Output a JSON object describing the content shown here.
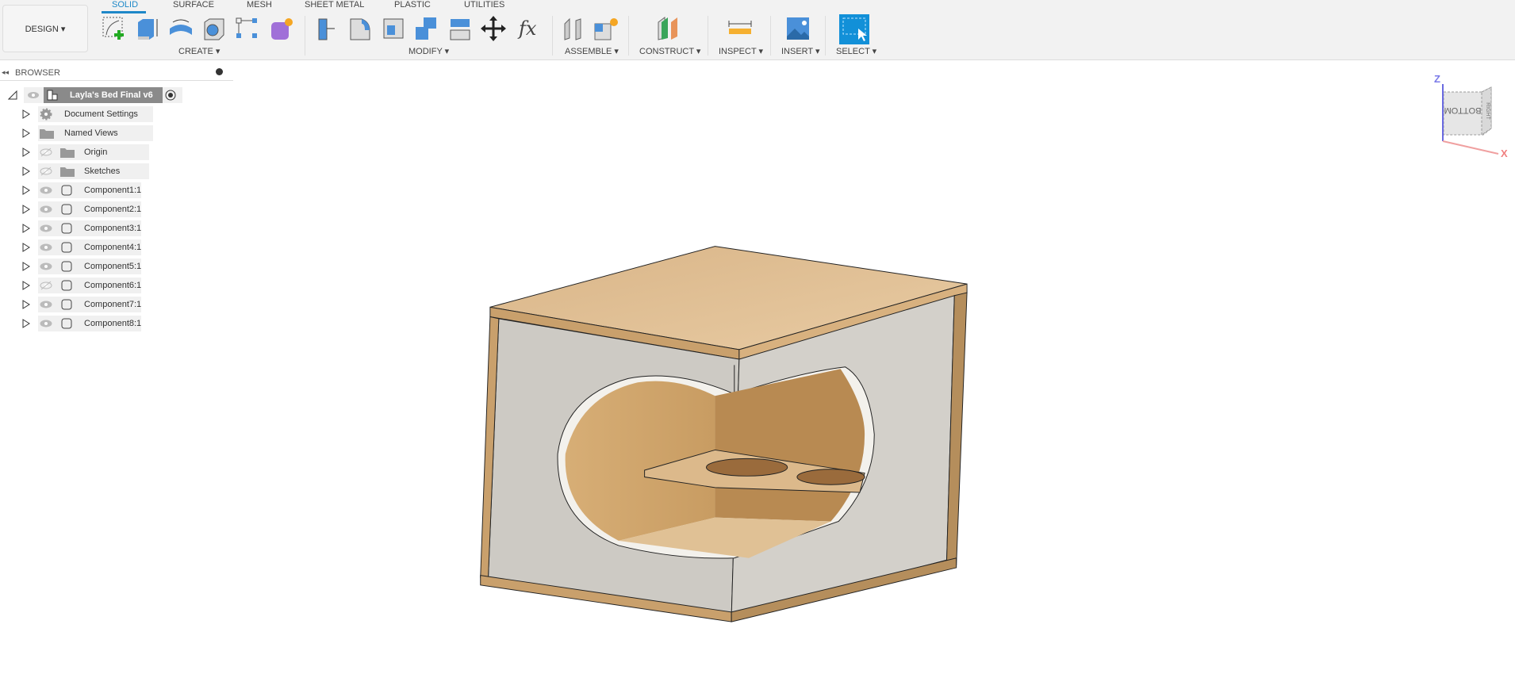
{
  "toolbar": {
    "workspace": "DESIGN ▾",
    "tabs": [
      "SOLID",
      "SURFACE",
      "MESH",
      "SHEET METAL",
      "PLASTIC",
      "UTILITIES"
    ],
    "active_tab": "SOLID",
    "groups": {
      "create": "CREATE ▾",
      "modify": "MODIFY ▾",
      "assemble": "ASSEMBLE ▾",
      "construct": "CONSTRUCT ▾",
      "inspect": "INSPECT ▾",
      "insert": "INSERT ▾",
      "select": "SELECT ▾"
    },
    "accent": "#1e88c8"
  },
  "browser": {
    "title": "BROWSER",
    "root": "Layla's Bed Final v6",
    "items": [
      {
        "label": "Document Settings",
        "icon": "gear-icon"
      },
      {
        "label": "Named Views",
        "icon": "folder-icon"
      },
      {
        "label": "Origin",
        "icon": "folder-icon",
        "visible": false
      },
      {
        "label": "Sketches",
        "icon": "folder-icon",
        "visible": false
      },
      {
        "label": "Component1:1",
        "icon": "component-icon",
        "visible": true
      },
      {
        "label": "Component2:1",
        "icon": "component-icon",
        "visible": true
      },
      {
        "label": "Component3:1",
        "icon": "component-icon",
        "visible": true
      },
      {
        "label": "Component4:1",
        "icon": "component-icon",
        "visible": true
      },
      {
        "label": "Component5:1",
        "icon": "component-icon",
        "visible": true
      },
      {
        "label": "Component6:1",
        "icon": "component-icon",
        "visible": false
      },
      {
        "label": "Component7:1",
        "icon": "component-icon",
        "visible": true
      },
      {
        "label": "Component8:1",
        "icon": "component-icon",
        "visible": true
      }
    ]
  },
  "viewcube": {
    "face": "BOTTOM",
    "side": "RIGHT",
    "axis_z": "Z",
    "axis_x": "X"
  }
}
